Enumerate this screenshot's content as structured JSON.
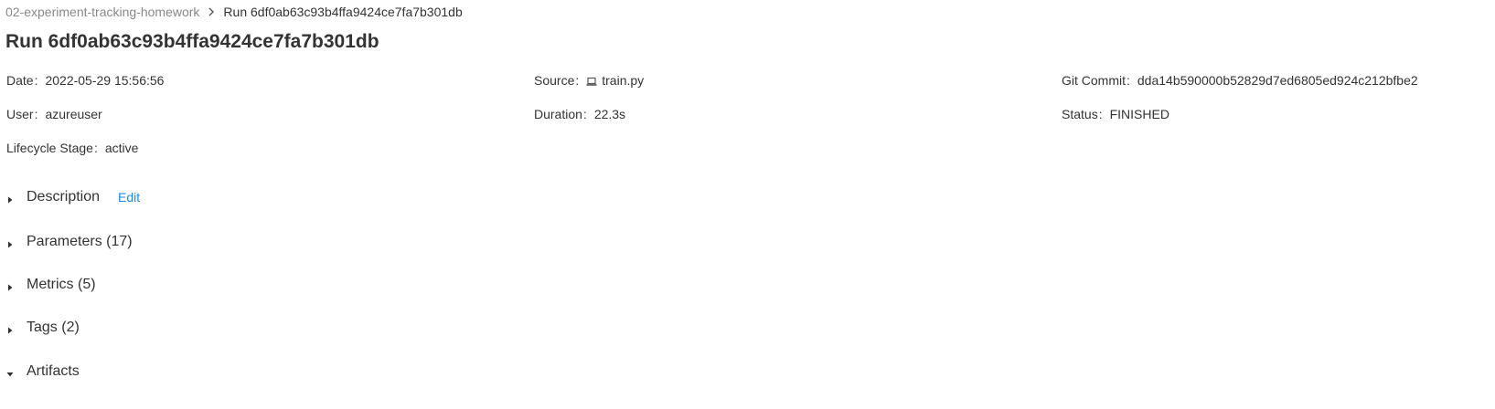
{
  "breadcrumb": {
    "experiment": "02-experiment-tracking-homework",
    "current": "Run 6df0ab63c93b4ffa9424ce7fa7b301db"
  },
  "title": "Run 6df0ab63c93b4ffa9424ce7fa7b301db",
  "metadata": {
    "date_label": "Date",
    "date_value": "2022-05-29 15:56:56",
    "source_label": "Source",
    "source_value": "train.py",
    "git_label": "Git Commit",
    "git_value": "dda14b590000b52829d7ed6805ed924c212bfbe2",
    "user_label": "User",
    "user_value": "azureuser",
    "duration_label": "Duration",
    "duration_value": "22.3s",
    "status_label": "Status",
    "status_value": "FINISHED",
    "lifecycle_label": "Lifecycle Stage",
    "lifecycle_value": "active",
    "colon": ":"
  },
  "sections": {
    "description": "Description",
    "edit": "Edit",
    "parameters": "Parameters (17)",
    "metrics": "Metrics (5)",
    "tags": "Tags (2)",
    "artifacts": "Artifacts"
  },
  "icons": {
    "breadcrumb_separator": "chevron-right-icon",
    "source": "laptop-icon",
    "collapsed": "caret-right-icon",
    "expanded": "caret-down-icon"
  },
  "colors": {
    "link": "#1a8ae6",
    "text": "#333333",
    "muted": "#888888"
  }
}
